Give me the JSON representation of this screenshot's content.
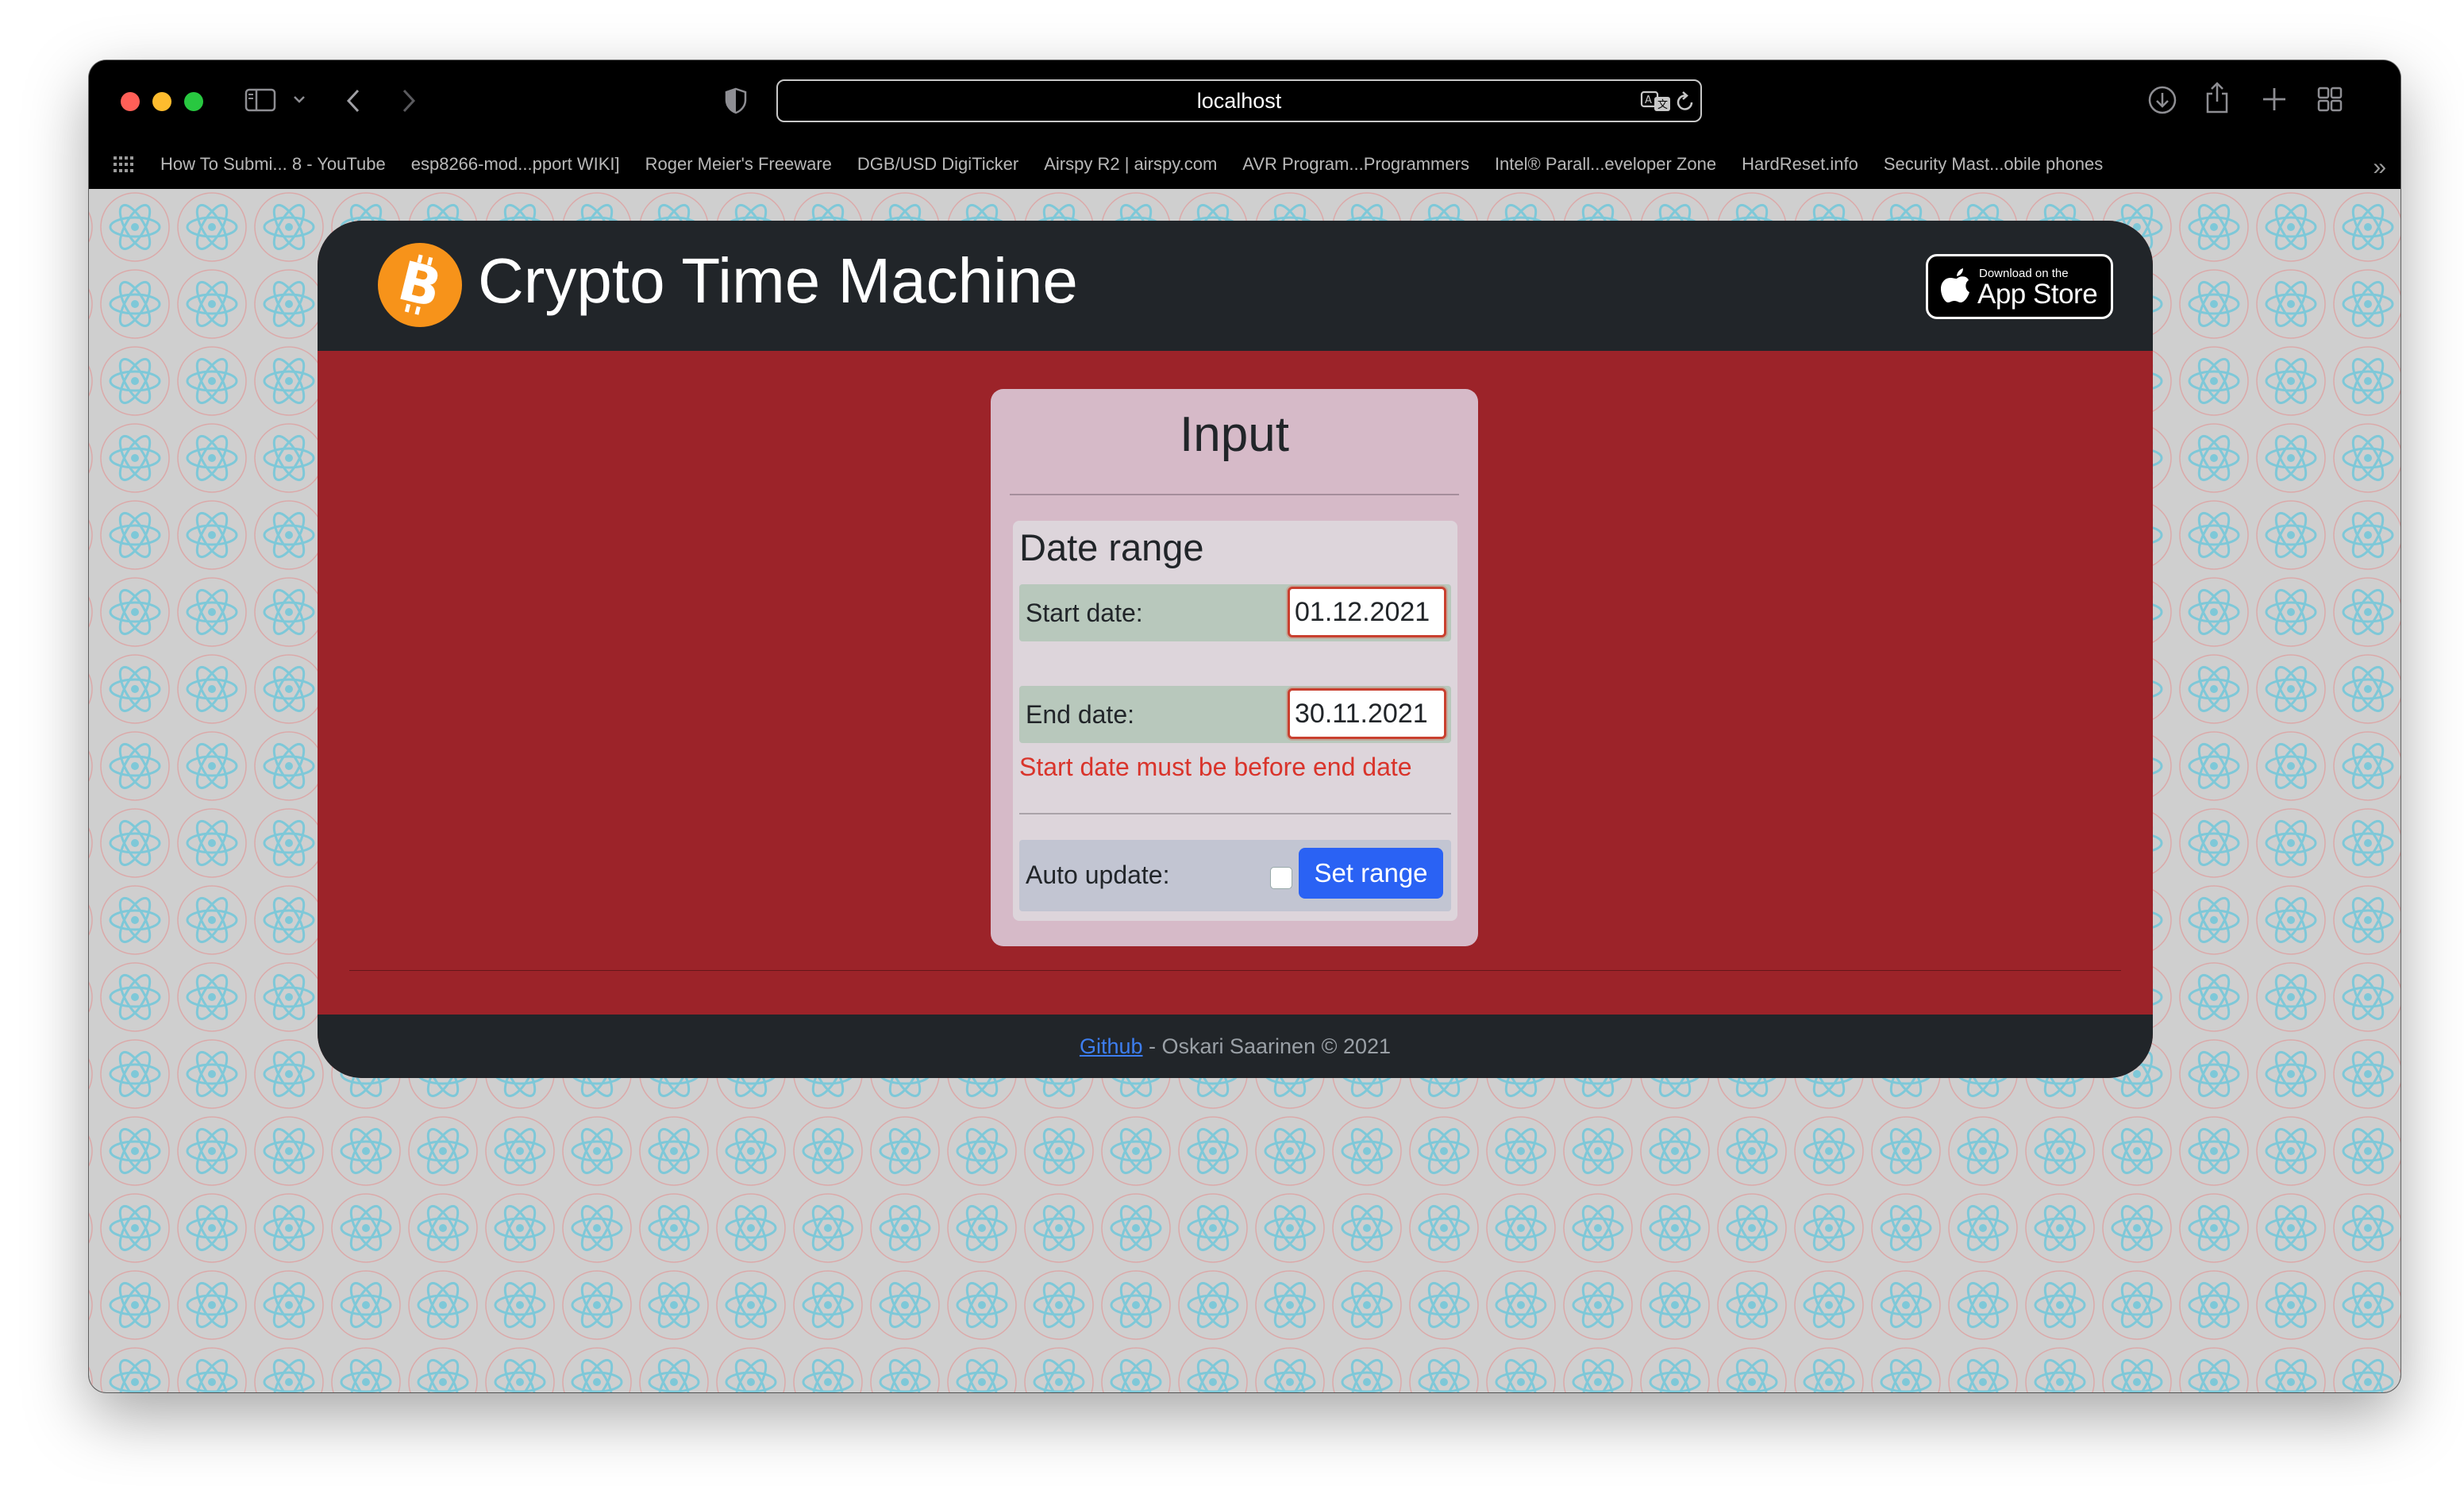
{
  "browser": {
    "url": "localhost",
    "bookmarks": [
      "How To Submi... 8 - YouTube",
      "esp8266-mod...pport WIKI]",
      "Roger Meier's Freeware",
      "DGB/USD DigiTicker",
      "Airspy R2 | airspy.com",
      "AVR Program...Programmers",
      "Intel® Parall...eveloper Zone",
      "HardReset.info",
      "Security Mast...obile phones"
    ],
    "icons": [
      "sidebar-icon",
      "chevron-down-icon",
      "back-arrow-icon",
      "forward-arrow-icon",
      "shield-icon",
      "translate-icon",
      "reload-icon",
      "download-icon",
      "share-icon",
      "plus-icon",
      "tab-overview-icon",
      "grid-icon",
      "double-chevron-icon"
    ]
  },
  "app": {
    "title": "Crypto Time Machine",
    "appstore_small": "Download on the",
    "appstore_big": "App Store",
    "colors": {
      "header": "#212529",
      "background": "#9c2329",
      "bitcoin": "#f7931a",
      "button": "#2a62f4",
      "error": "#d9342b"
    }
  },
  "input": {
    "title": "Input",
    "date_range_title": "Date range",
    "start_label": "Start date:",
    "start_value": "01.12.2021",
    "end_label": "End date:",
    "end_value": "30.11.2021",
    "error": "Start date must be before end date",
    "auto_update_label": "Auto update:",
    "auto_update_checked": false,
    "set_range_label": "Set range"
  },
  "footer": {
    "link_text": "Github",
    "text": " - Oskari Saarinen © 2021"
  }
}
